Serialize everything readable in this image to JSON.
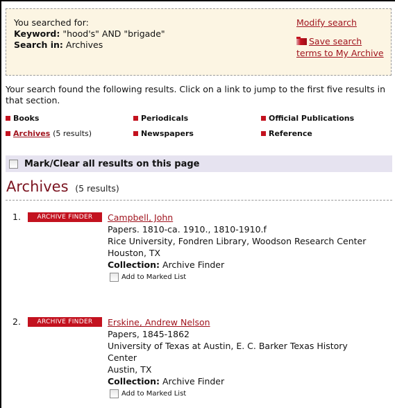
{
  "search_summary": {
    "heading": "You searched for:",
    "keyword_label": "Keyword:",
    "keyword_value": "\"hood's\" AND \"brigade\"",
    "search_in_label": "Search in:",
    "search_in_value": "Archives",
    "modify_link": "Modify search",
    "save_link": "Save search terms to My Archive"
  },
  "intro_text": "Your search found the following results. Click on a link to jump to the first five results in that section.",
  "categories": [
    {
      "label": "Books",
      "count": ""
    },
    {
      "label": "Periodicals",
      "count": ""
    },
    {
      "label": "Official Publications",
      "count": ""
    },
    {
      "label": "Archives",
      "count": "(5 results)"
    },
    {
      "label": "Newspapers",
      "count": ""
    },
    {
      "label": "Reference",
      "count": ""
    }
  ],
  "mark_all_label": "Mark/Clear all results on this page",
  "section": {
    "title": "Archives",
    "count": "(5 results)"
  },
  "results": [
    {
      "number": "1.",
      "badge": "ARCHIVE FINDER",
      "title": "Campbell, John",
      "lines": [
        "Papers. 1810-ca. 1910., 1810-1910.f",
        "Rice University, Fondren Library, Woodson Research Center",
        "Houston, TX"
      ],
      "collection_label": "Collection:",
      "collection_value": "Archive Finder",
      "add_label": "Add to Marked List"
    },
    {
      "number": "2.",
      "badge": "ARCHIVE FINDER",
      "title": "Erskine, Andrew Nelson",
      "lines": [
        "Papers, 1845-1862",
        "University of Texas at Austin, E. C. Barker Texas History",
        "Center",
        "Austin, TX"
      ],
      "collection_label": "Collection:",
      "collection_value": "Archive Finder",
      "add_label": "Add to Marked List"
    }
  ],
  "colors": {
    "accent_red": "#c3121f",
    "link_red": "#a0141e",
    "section_title": "#7b1420",
    "search_box_bg": "#fcf5e3",
    "mark_bar_bg": "#e6e3f0"
  }
}
